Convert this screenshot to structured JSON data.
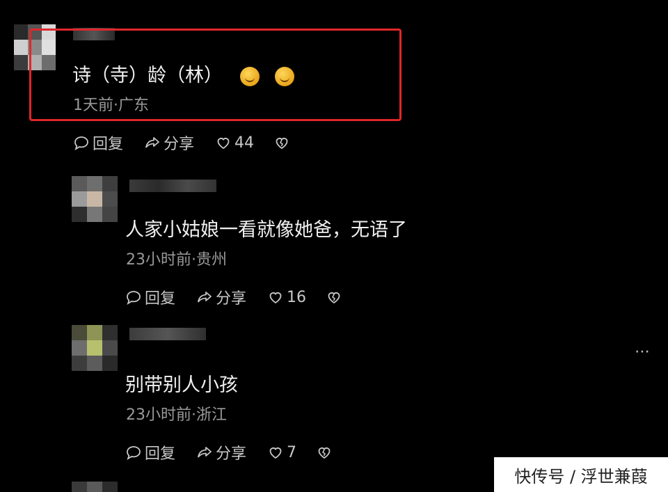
{
  "comments": [
    {
      "text": "诗（寺）龄（林）",
      "meta": "1天前·广东",
      "reply": "回复",
      "share": "分享",
      "likes": "44"
    },
    {
      "text": "人家小姑娘一看就像她爸，无语了",
      "meta": "23小时前·贵州",
      "reply": "回复",
      "share": "分享",
      "likes": "16"
    },
    {
      "text": "别带别人小孩",
      "meta": "23小时前·浙江",
      "reply": "回复",
      "share": "分享",
      "likes": "7"
    }
  ],
  "more_icon": "⋯",
  "highlight_color": "#e0262b",
  "watermark": "快传号 / 浮世兼葭"
}
